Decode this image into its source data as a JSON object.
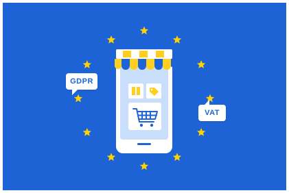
{
  "labels": {
    "gdpr": "GDPR",
    "vat": "VAT"
  },
  "colors": {
    "background": "#1e63d6",
    "star": "#ffd200",
    "phone_body": "#ffffff",
    "screen": "#c9defa",
    "awning_yellow": "#ffcf1f",
    "awning_blue": "#1e63d6",
    "icon_stroke": "#1e63d6",
    "bubble_text": "#1e63d6"
  },
  "icons": [
    "star-icon",
    "shopping-cart-icon",
    "tag-icon",
    "product-box-icon",
    "store-awning-icon",
    "smartphone-icon"
  ]
}
